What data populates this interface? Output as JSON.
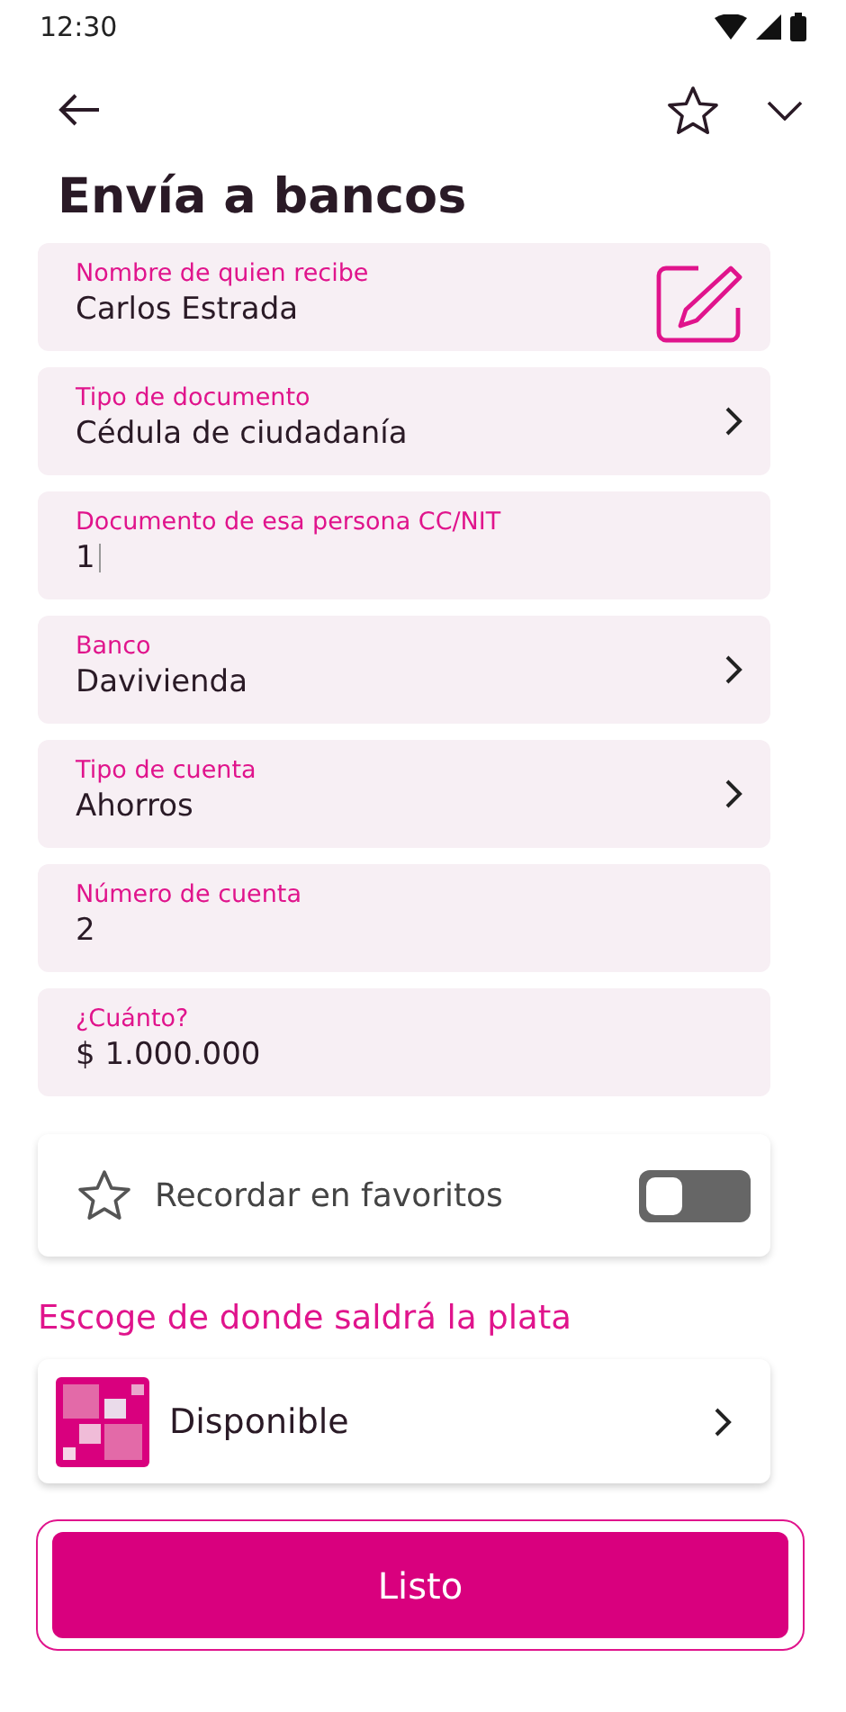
{
  "status_bar": {
    "time": "12:30"
  },
  "header": {
    "title": "Envía a bancos"
  },
  "fields": [
    {
      "kind": "edit",
      "label": "Nombre de quien recibe",
      "value": "Carlos Estrada",
      "focused": false
    },
    {
      "kind": "select",
      "label": "Tipo de documento",
      "value": "Cédula de ciudadanía",
      "focused": false
    },
    {
      "kind": "text",
      "label": "Documento de esa persona CC/NIT",
      "value": "1",
      "focused": true
    },
    {
      "kind": "select",
      "label": "Banco",
      "value": "Davivienda",
      "focused": false
    },
    {
      "kind": "select",
      "label": "Tipo de cuenta",
      "value": "Ahorros",
      "focused": false
    },
    {
      "kind": "text",
      "label": "Número de cuenta",
      "value": "2",
      "focused": false
    },
    {
      "kind": "text",
      "label": "¿Cuánto?",
      "value": "$ 1.000.000",
      "focused": false
    }
  ],
  "favorite": {
    "label": "Recordar en favoritos",
    "on": false
  },
  "source": {
    "heading": "Escoge de donde saldrá la plata",
    "name": "Disponible"
  },
  "submit": {
    "label": "Listo",
    "focused": true
  }
}
